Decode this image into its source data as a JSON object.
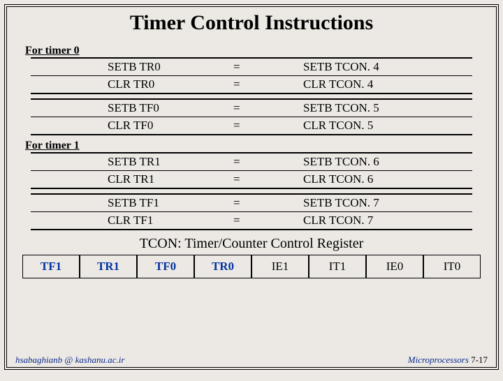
{
  "title": "Timer Control Instructions",
  "sections": [
    {
      "label": "For timer 0",
      "blocks": [
        [
          {
            "left": "SETB  TR0",
            "eq": "=",
            "right": "SETB  TCON. 4"
          },
          {
            "left": "CLR    TR0",
            "eq": "=",
            "right": "CLR    TCON. 4"
          }
        ],
        [
          {
            "left": "SETB  TF0",
            "eq": "=",
            "right": "SETB  TCON. 5"
          },
          {
            "left": "CLR    TF0",
            "eq": "=",
            "right": "CLR    TCON. 5"
          }
        ]
      ]
    },
    {
      "label": "For timer 1",
      "blocks": [
        [
          {
            "left": "SETB  TR1",
            "eq": "=",
            "right": "SETB  TCON. 6"
          },
          {
            "left": "CLR    TR1",
            "eq": "=",
            "right": "CLR    TCON. 6"
          }
        ],
        [
          {
            "left": "SETB  TF1",
            "eq": "=",
            "right": "SETB  TCON. 7"
          },
          {
            "left": "CLR    TF1",
            "eq": "=",
            "right": "CLR    TCON. 7"
          }
        ]
      ]
    }
  ],
  "tcon": {
    "caption": "TCON: Timer/Counter Control Register",
    "bits": [
      {
        "name": "TF1",
        "hl": true
      },
      {
        "name": "TR1",
        "hl": true
      },
      {
        "name": "TF0",
        "hl": true
      },
      {
        "name": "TR0",
        "hl": true
      },
      {
        "name": "IE1",
        "hl": false
      },
      {
        "name": "IT1",
        "hl": false
      },
      {
        "name": "IE0",
        "hl": false
      },
      {
        "name": "IT0",
        "hl": false
      }
    ]
  },
  "footer": {
    "left": "hsabaghianb @ kashanu.ac.ir",
    "right_label": "Microprocessors",
    "page": "7-17"
  }
}
